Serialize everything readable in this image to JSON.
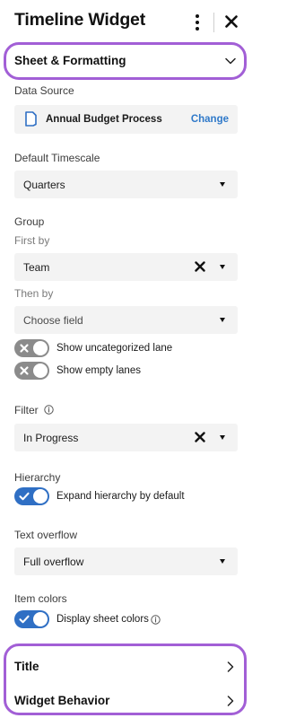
{
  "header": {
    "title": "Timeline Widget"
  },
  "sections": {
    "sheet_formatting": "Sheet & Formatting",
    "title": "Title",
    "widget_behavior": "Widget Behavior"
  },
  "data_source": {
    "label": "Data Source",
    "name": "Annual Budget Process",
    "change_label": "Change"
  },
  "timescale": {
    "label": "Default Timescale",
    "value": "Quarters"
  },
  "group": {
    "label": "Group",
    "first_by_label": "First by",
    "first_by_value": "Team",
    "then_by_label": "Then by",
    "then_by_placeholder": "Choose field",
    "show_uncategorized": "Show uncategorized lane",
    "show_empty": "Show empty lanes"
  },
  "filter": {
    "label": "Filter",
    "value": "In Progress"
  },
  "hierarchy": {
    "label": "Hierarchy",
    "expand_label": "Expand hierarchy by default"
  },
  "text_overflow": {
    "label": "Text overflow",
    "value": "Full overflow"
  },
  "item_colors": {
    "label": "Item colors",
    "display_label": "Display sheet colors"
  },
  "colors": {
    "accent_outline": "#a25fd6",
    "toggle_on": "#2f6fc4",
    "toggle_off": "#8b8b8b",
    "link": "#2f79c9"
  }
}
